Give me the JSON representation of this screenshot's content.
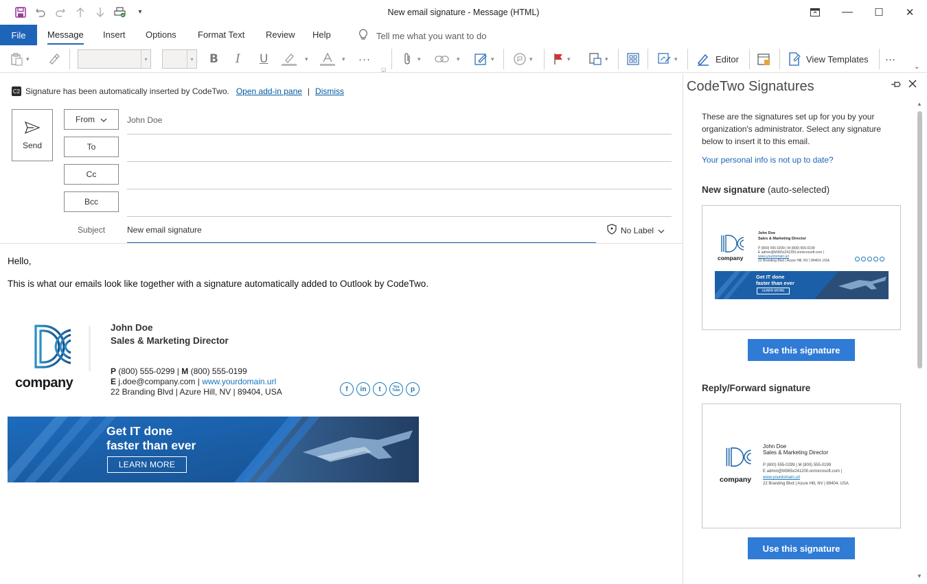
{
  "window": {
    "title": "New email signature  -  Message (HTML)",
    "controls": {
      "restore_icon": "ribbon-display-icon",
      "minimize": "—",
      "maximize": "☐",
      "close": "✕"
    }
  },
  "quick_access": {
    "icons": [
      "save-icon",
      "undo-icon",
      "redo-icon",
      "up-arrow-icon",
      "down-arrow-icon",
      "print-icon",
      "customize-icon"
    ]
  },
  "ribbon": {
    "file_tab": "File",
    "tabs": [
      "Message",
      "Insert",
      "Options",
      "Format Text",
      "Review",
      "Help"
    ],
    "active_tab": "Message",
    "tell_me": "Tell me what you want to do",
    "tools": {
      "editor_label": "Editor",
      "view_templates_label": "View Templates",
      "more": "···"
    }
  },
  "infobar": {
    "logo_text": "C2",
    "message": "Signature has been automatically inserted by CodeTwo.",
    "open_pane_link": "Open add-in pane",
    "separator": "|",
    "dismiss_link": "Dismiss"
  },
  "compose": {
    "send_label": "Send",
    "from_label": "From",
    "from_value": "John Doe",
    "to_label": "To",
    "cc_label": "Cc",
    "bcc_label": "Bcc",
    "subject_label": "Subject",
    "subject_value": "New email signature",
    "sensitivity_label": "No Label"
  },
  "body": {
    "greeting": "Hello,",
    "paragraph": "This is what our emails look like together with a signature automatically added to Outlook by CodeTwo."
  },
  "signature": {
    "logo_word": "company",
    "name": "John Doe",
    "title": "Sales & Marketing Director",
    "phone_prefix": "P",
    "phone": "(800) 555-0299",
    "mobile_prefix": "M",
    "mobile": "(800) 555-0199",
    "email_prefix": "E",
    "email": "j.doe@company.com",
    "pipe": "|",
    "website": "www.yourdomain.url",
    "address": "22 Branding Blvd | Azure Hill, NV | 89404, USA",
    "social": [
      "f",
      "in",
      "t",
      "You Tube",
      "p"
    ],
    "social_icons": [
      "facebook-icon",
      "linkedin-icon",
      "twitter-icon",
      "youtube-icon",
      "pinterest-icon"
    ],
    "banner_title_1": "Get IT done",
    "banner_title_2": "faster than ever",
    "banner_cta": "LEARN MORE"
  },
  "pane": {
    "title": "CodeTwo Signatures",
    "intro": "These are the signatures set up for you by your organization's administrator. Select any signature below to insert it to this email.",
    "info_link": "Your personal info is not up to date?",
    "new_sig_heading": "New signature",
    "new_sig_suffix": "(auto-selected)",
    "reply_sig_heading": "Reply/Forward signature",
    "use_button": "Use this signature",
    "thumb1": {
      "name": "John Doe",
      "title": "Sales & Marketing Director",
      "phones": "P (800) 555-0299 | M (800) 555-0199",
      "email": "E admin@M365x241200.onmicrosoft.com |",
      "web": "www.yourdomain.url",
      "address": "22 Branding Blvd | Azure Hill, NV | 89404, USA",
      "logo_word": "company",
      "banner_title_1": "Get IT done",
      "banner_title_2": "faster than ever",
      "banner_cta": "LEARN MORE"
    },
    "thumb2": {
      "name": "John Doe",
      "title": "Sales & Marketing Director",
      "phones": "P (800) 555-0299 | M (800) 555-0199",
      "email": "E admin@M365x241200.onmicrosoft.com |",
      "web": "www.yourdomain.url",
      "address": "22 Branding Blvd | Azure Hill, NV | 89404, USA",
      "logo_word": "company"
    }
  },
  "colors": {
    "accent": "#1e64b9",
    "use_button": "#2f7bd6",
    "banner": "#1b5fa8",
    "flag": "#d13438"
  }
}
